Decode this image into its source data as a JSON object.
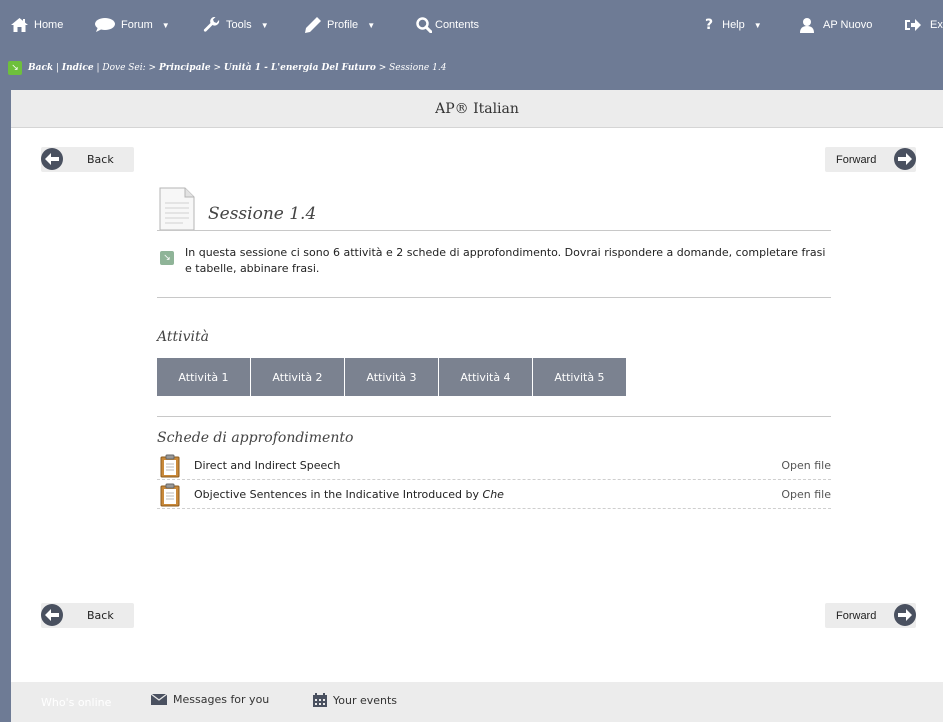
{
  "nav": {
    "home": "Home",
    "forum": "Forum",
    "tools": "Tools",
    "profile": "Profile",
    "contents": "Contents",
    "help": "Help",
    "user": "AP Nuovo",
    "exit": "Ex"
  },
  "breadcrumb": {
    "back": "Back",
    "sep1": " | ",
    "indice": "Indice",
    "sep2": " | ",
    "dove_sei": "Dove Sei: > ",
    "principale": "Principale",
    "arrow1": " > ",
    "unita": "Unità 1 - L'energia Del Futuro",
    "arrow2": " > ",
    "current": "Sessione 1.4"
  },
  "course_title": "AP® Italian",
  "back_label": "Back",
  "forward_label": "Forward",
  "session": {
    "title": "Sessione 1.4",
    "intro": "In questa sessione ci sono 6 attività e 2 schede di approfondimento. Dovrai rispondere a domande, completare frasi e tabelle, abbinare frasi."
  },
  "activities": {
    "heading": "Attività",
    "items": [
      "Attività 1",
      "Attività 2",
      "Attività 3",
      "Attività 4",
      "Attività 5"
    ]
  },
  "schede": {
    "heading": "Schede di approfondimento",
    "files": [
      {
        "name": "Direct and Indirect Speech",
        "em": "",
        "action": "Open file"
      },
      {
        "name": "Objective Sentences in the Indicative Introduced by ",
        "em": "Che",
        "action": "Open file"
      }
    ]
  },
  "footer": {
    "whos_online": "Who's online",
    "messages": "Messages for you",
    "events": "Your events"
  },
  "colors": {
    "nav_bg": "#6e7b95",
    "activity_button": "#7b8290",
    "accent_green": "#6ec03c",
    "nav_circle": "#4a5160"
  }
}
